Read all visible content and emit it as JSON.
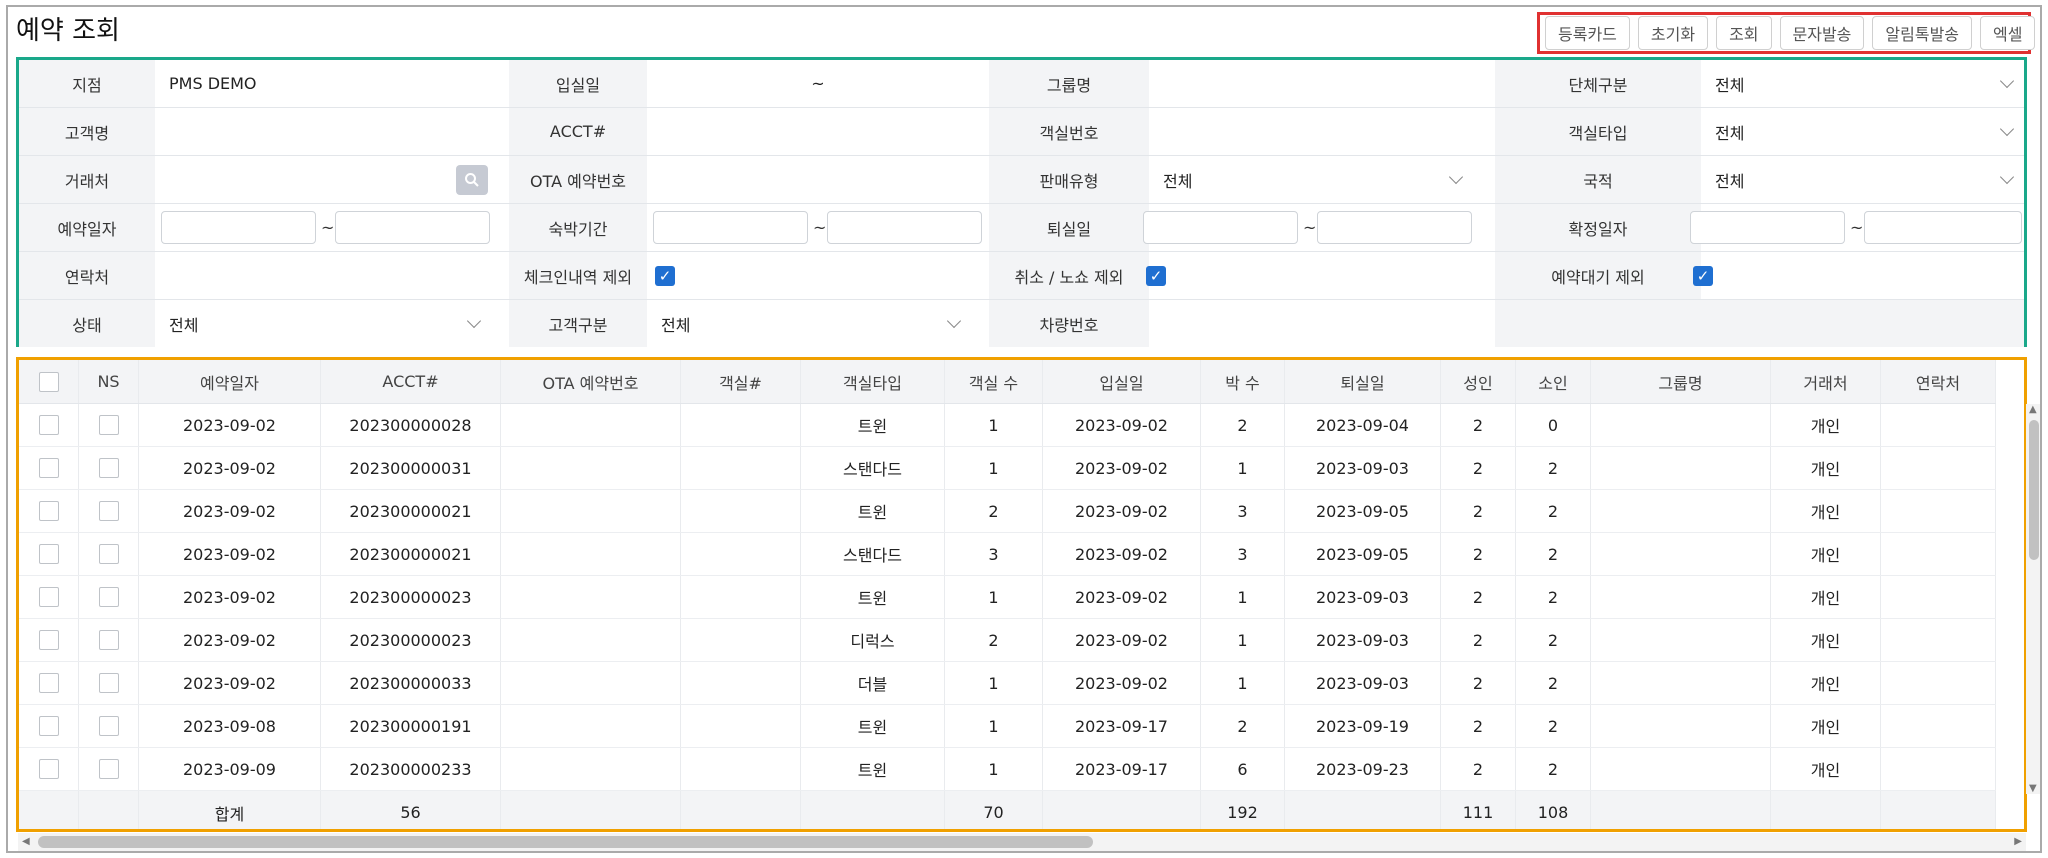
{
  "title": "예약 조회",
  "toolbar": [
    "등록카드",
    "초기화",
    "조회",
    "문자발송",
    "알림톡발송",
    "엑셀"
  ],
  "filters": {
    "branch_label": "지점",
    "branch_value": "PMS DEMO",
    "checkin_label": "입실일",
    "checkin_tilde": "~",
    "group_label": "그룹명",
    "grouptype_label": "단체구분",
    "grouptype_value": "전체",
    "guest_label": "고객명",
    "acct_label": "ACCT#",
    "roomno_label": "객실번호",
    "roomtype_label": "객실타입",
    "roomtype_value": "전체",
    "client_label": "거래처",
    "ota_label": "OTA 예약번호",
    "saletype_label": "판매유형",
    "saletype_value": "전체",
    "nation_label": "국적",
    "nation_value": "전체",
    "resdate_label": "예약일자",
    "stay_label": "숙박기간",
    "checkout_label": "퇴실일",
    "confirm_label": "확정일자",
    "contact_label": "연락처",
    "excl_checkin_label": "체크인내역 제외",
    "excl_cancel_label": "취소 / 노쇼 제외",
    "excl_wait_label": "예약대기 제외",
    "status_label": "상태",
    "status_value": "전체",
    "guesttype_label": "고객구분",
    "guesttype_value": "전체",
    "car_label": "차량번호",
    "tilde": "~"
  },
  "grid": {
    "columns": [
      "NS",
      "예약일자",
      "ACCT#",
      "OTA 예약번호",
      "객실#",
      "객실타입",
      "객실 수",
      "입실일",
      "박 수",
      "퇴실일",
      "성인",
      "소인",
      "그룹명",
      "거래처",
      "연락처"
    ],
    "rows": [
      [
        "2023-09-02",
        "202300000028",
        "",
        "",
        "트윈",
        "1",
        "2023-09-02",
        "2",
        "2023-09-04",
        "2",
        "0",
        "",
        "개인",
        ""
      ],
      [
        "2023-09-02",
        "202300000031",
        "",
        "",
        "스탠다드",
        "1",
        "2023-09-02",
        "1",
        "2023-09-03",
        "2",
        "2",
        "",
        "개인",
        ""
      ],
      [
        "2023-09-02",
        "202300000021",
        "",
        "",
        "트윈",
        "2",
        "2023-09-02",
        "3",
        "2023-09-05",
        "2",
        "2",
        "",
        "개인",
        ""
      ],
      [
        "2023-09-02",
        "202300000021",
        "",
        "",
        "스탠다드",
        "3",
        "2023-09-02",
        "3",
        "2023-09-05",
        "2",
        "2",
        "",
        "개인",
        ""
      ],
      [
        "2023-09-02",
        "202300000023",
        "",
        "",
        "트윈",
        "1",
        "2023-09-02",
        "1",
        "2023-09-03",
        "2",
        "2",
        "",
        "개인",
        ""
      ],
      [
        "2023-09-02",
        "202300000023",
        "",
        "",
        "디럭스",
        "2",
        "2023-09-02",
        "1",
        "2023-09-03",
        "2",
        "2",
        "",
        "개인",
        ""
      ],
      [
        "2023-09-02",
        "202300000033",
        "",
        "",
        "더블",
        "1",
        "2023-09-02",
        "1",
        "2023-09-03",
        "2",
        "2",
        "",
        "개인",
        ""
      ],
      [
        "2023-09-08",
        "202300000191",
        "",
        "",
        "트윈",
        "1",
        "2023-09-17",
        "2",
        "2023-09-19",
        "2",
        "2",
        "",
        "개인",
        ""
      ],
      [
        "2023-09-09",
        "202300000233",
        "",
        "",
        "트윈",
        "1",
        "2023-09-17",
        "6",
        "2023-09-23",
        "2",
        "2",
        "",
        "개인",
        ""
      ]
    ],
    "footer": {
      "label": "합계",
      "acct": "56",
      "rooms": "70",
      "nights": "192",
      "adults": "111",
      "children": "108"
    }
  },
  "colors": {
    "button_bar_border": "#e03131",
    "search_border": "#1aa88a",
    "grid_border": "#f0a000",
    "checkbox": "#1f6fd1"
  },
  "icons": [
    "search-icon",
    "chevron-down-icon",
    "check-icon"
  ]
}
